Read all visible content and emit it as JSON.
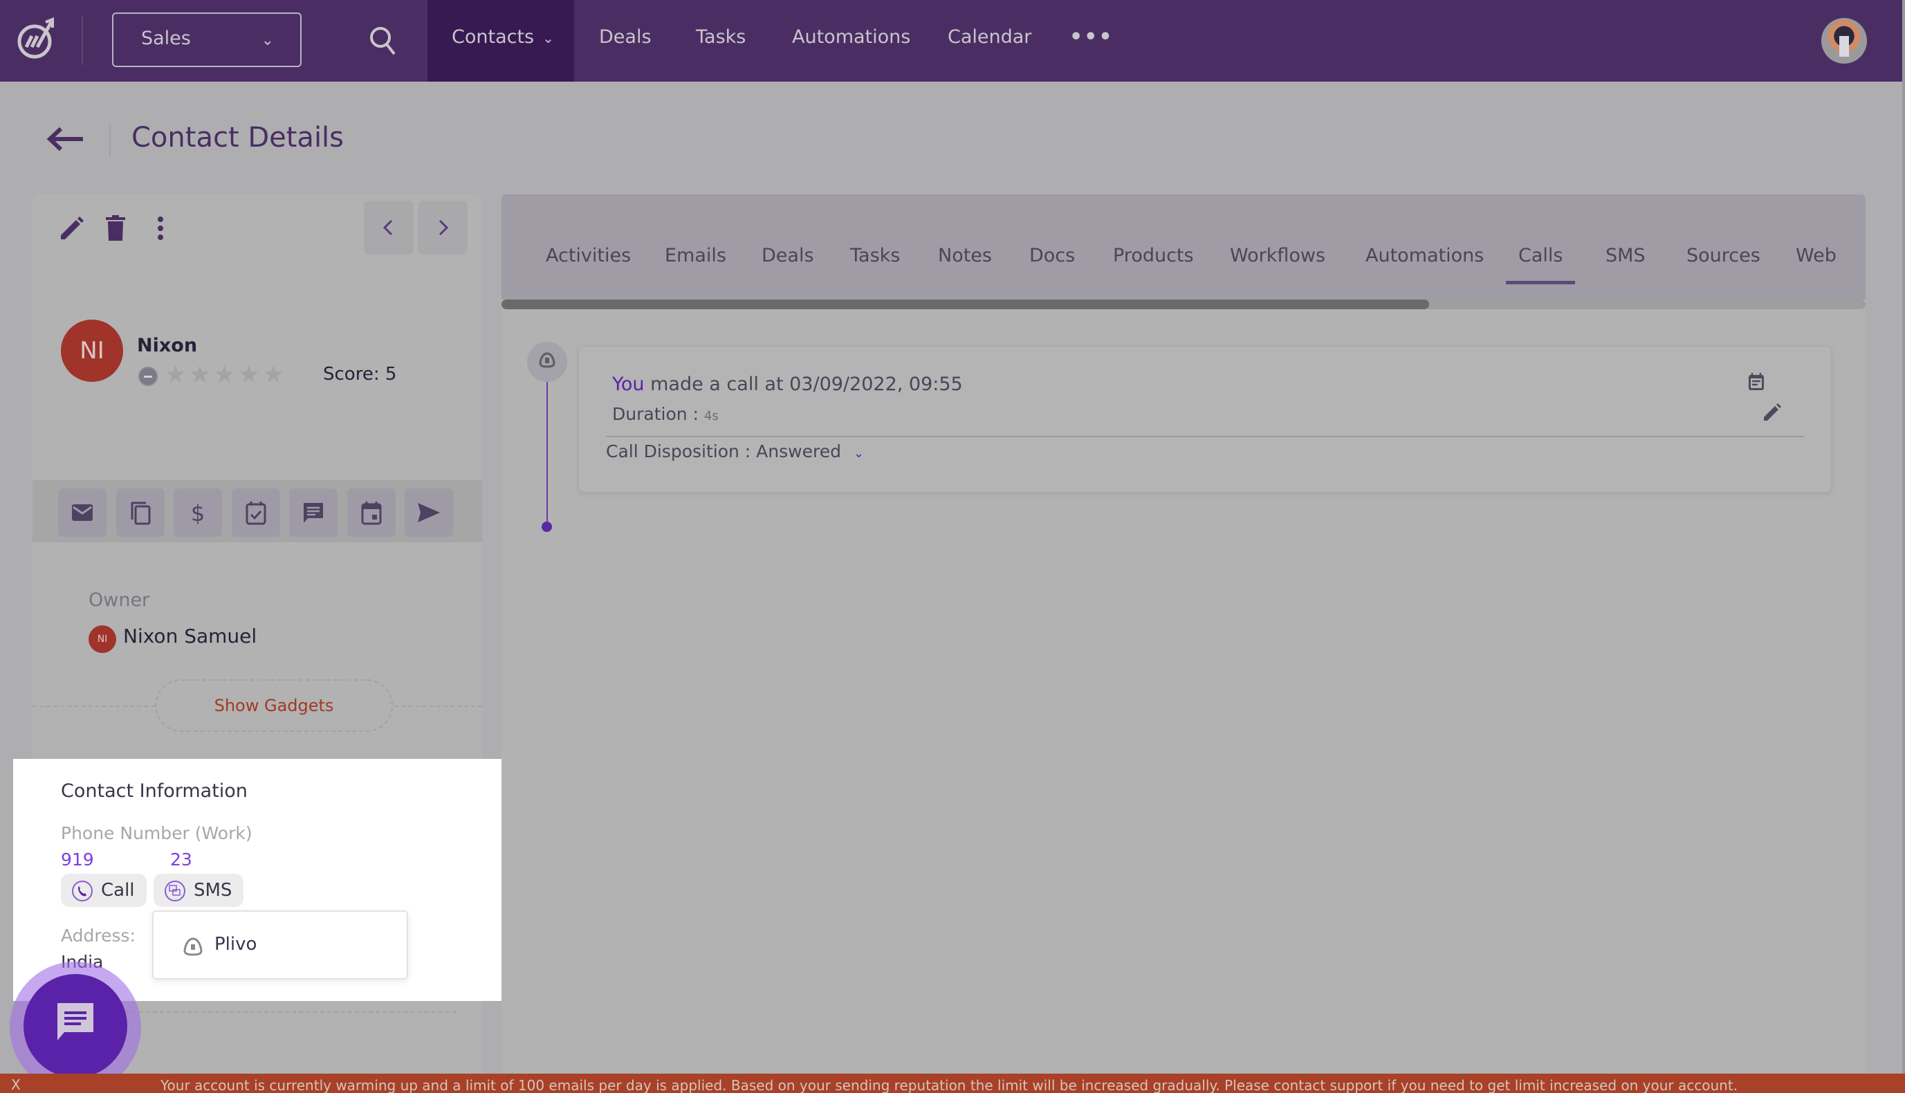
{
  "topbar": {
    "workspace_select": "Sales",
    "nav": [
      {
        "label": "Contacts",
        "active": true,
        "has_dropdown": true
      },
      {
        "label": "Deals"
      },
      {
        "label": "Tasks"
      },
      {
        "label": "Automations"
      },
      {
        "label": "Calendar"
      }
    ],
    "more_label": "•••",
    "icons": {
      "logo": "app-logo-icon",
      "search": "search-icon",
      "avatar": "user-avatar"
    }
  },
  "header": {
    "title": "Contact Details",
    "back_icon": "arrow-left-icon"
  },
  "contact_card": {
    "toolbar_icons": [
      "edit-icon",
      "trash-icon",
      "more-vertical-icon"
    ],
    "prev_icon": "chevron-left-icon",
    "next_icon": "chevron-right-icon",
    "initials": "NI",
    "name": "Nixon",
    "rating": {
      "stars": 0,
      "max": 5
    },
    "stars_glyph": "★★★★★",
    "score_label": "Score: 5",
    "quick_actions": [
      "email-icon",
      "copy-icon",
      "dollar-icon",
      "task-calendar-icon",
      "message-icon",
      "event-calendar-icon",
      "send-icon"
    ],
    "owner": {
      "label": "Owner",
      "initials": "NI",
      "name": "Nixon Samuel"
    },
    "show_gadgets_label": "Show Gadgets"
  },
  "contact_info": {
    "title": "Contact Information",
    "phone_label": "Phone Number (Work)",
    "phone_part_a": "919",
    "phone_part_b": "23",
    "call_label": "Call",
    "sms_label": "SMS",
    "address_label": "Address:",
    "address_value": "India",
    "dropdown_items": [
      {
        "label": "Plivo",
        "icon": "plivo-icon"
      }
    ]
  },
  "tabs": [
    {
      "label": "Activities"
    },
    {
      "label": "Emails"
    },
    {
      "label": "Deals"
    },
    {
      "label": "Tasks"
    },
    {
      "label": "Notes"
    },
    {
      "label": "Docs"
    },
    {
      "label": "Products"
    },
    {
      "label": "Workflows"
    },
    {
      "label": "Automations"
    },
    {
      "label": "Calls",
      "active": true
    },
    {
      "label": "SMS"
    },
    {
      "label": "Sources"
    },
    {
      "label": "Web"
    }
  ],
  "tabs_scroll_fraction": 0.68,
  "call_entry": {
    "actor": "You",
    "text": " made a call at 03/09/2022, 09:55",
    "duration_label": "Duration : ",
    "duration_value": "4s",
    "disposition": "Call Disposition : Answered",
    "icons": [
      "calendar-note-icon",
      "edit-icon",
      "plivo-icon"
    ]
  },
  "banner": {
    "close_label": "X",
    "text": "Your account is currently warming up and a limit of 100 emails per day is applied. Based on your sending reputation the limit will be increased gradually. Please contact support if you need to get limit increased on your account."
  },
  "colors": {
    "brand": "#4a2e63",
    "accent": "#7b3fe4",
    "avatar": "#a0342a",
    "banner": "#a84127"
  }
}
